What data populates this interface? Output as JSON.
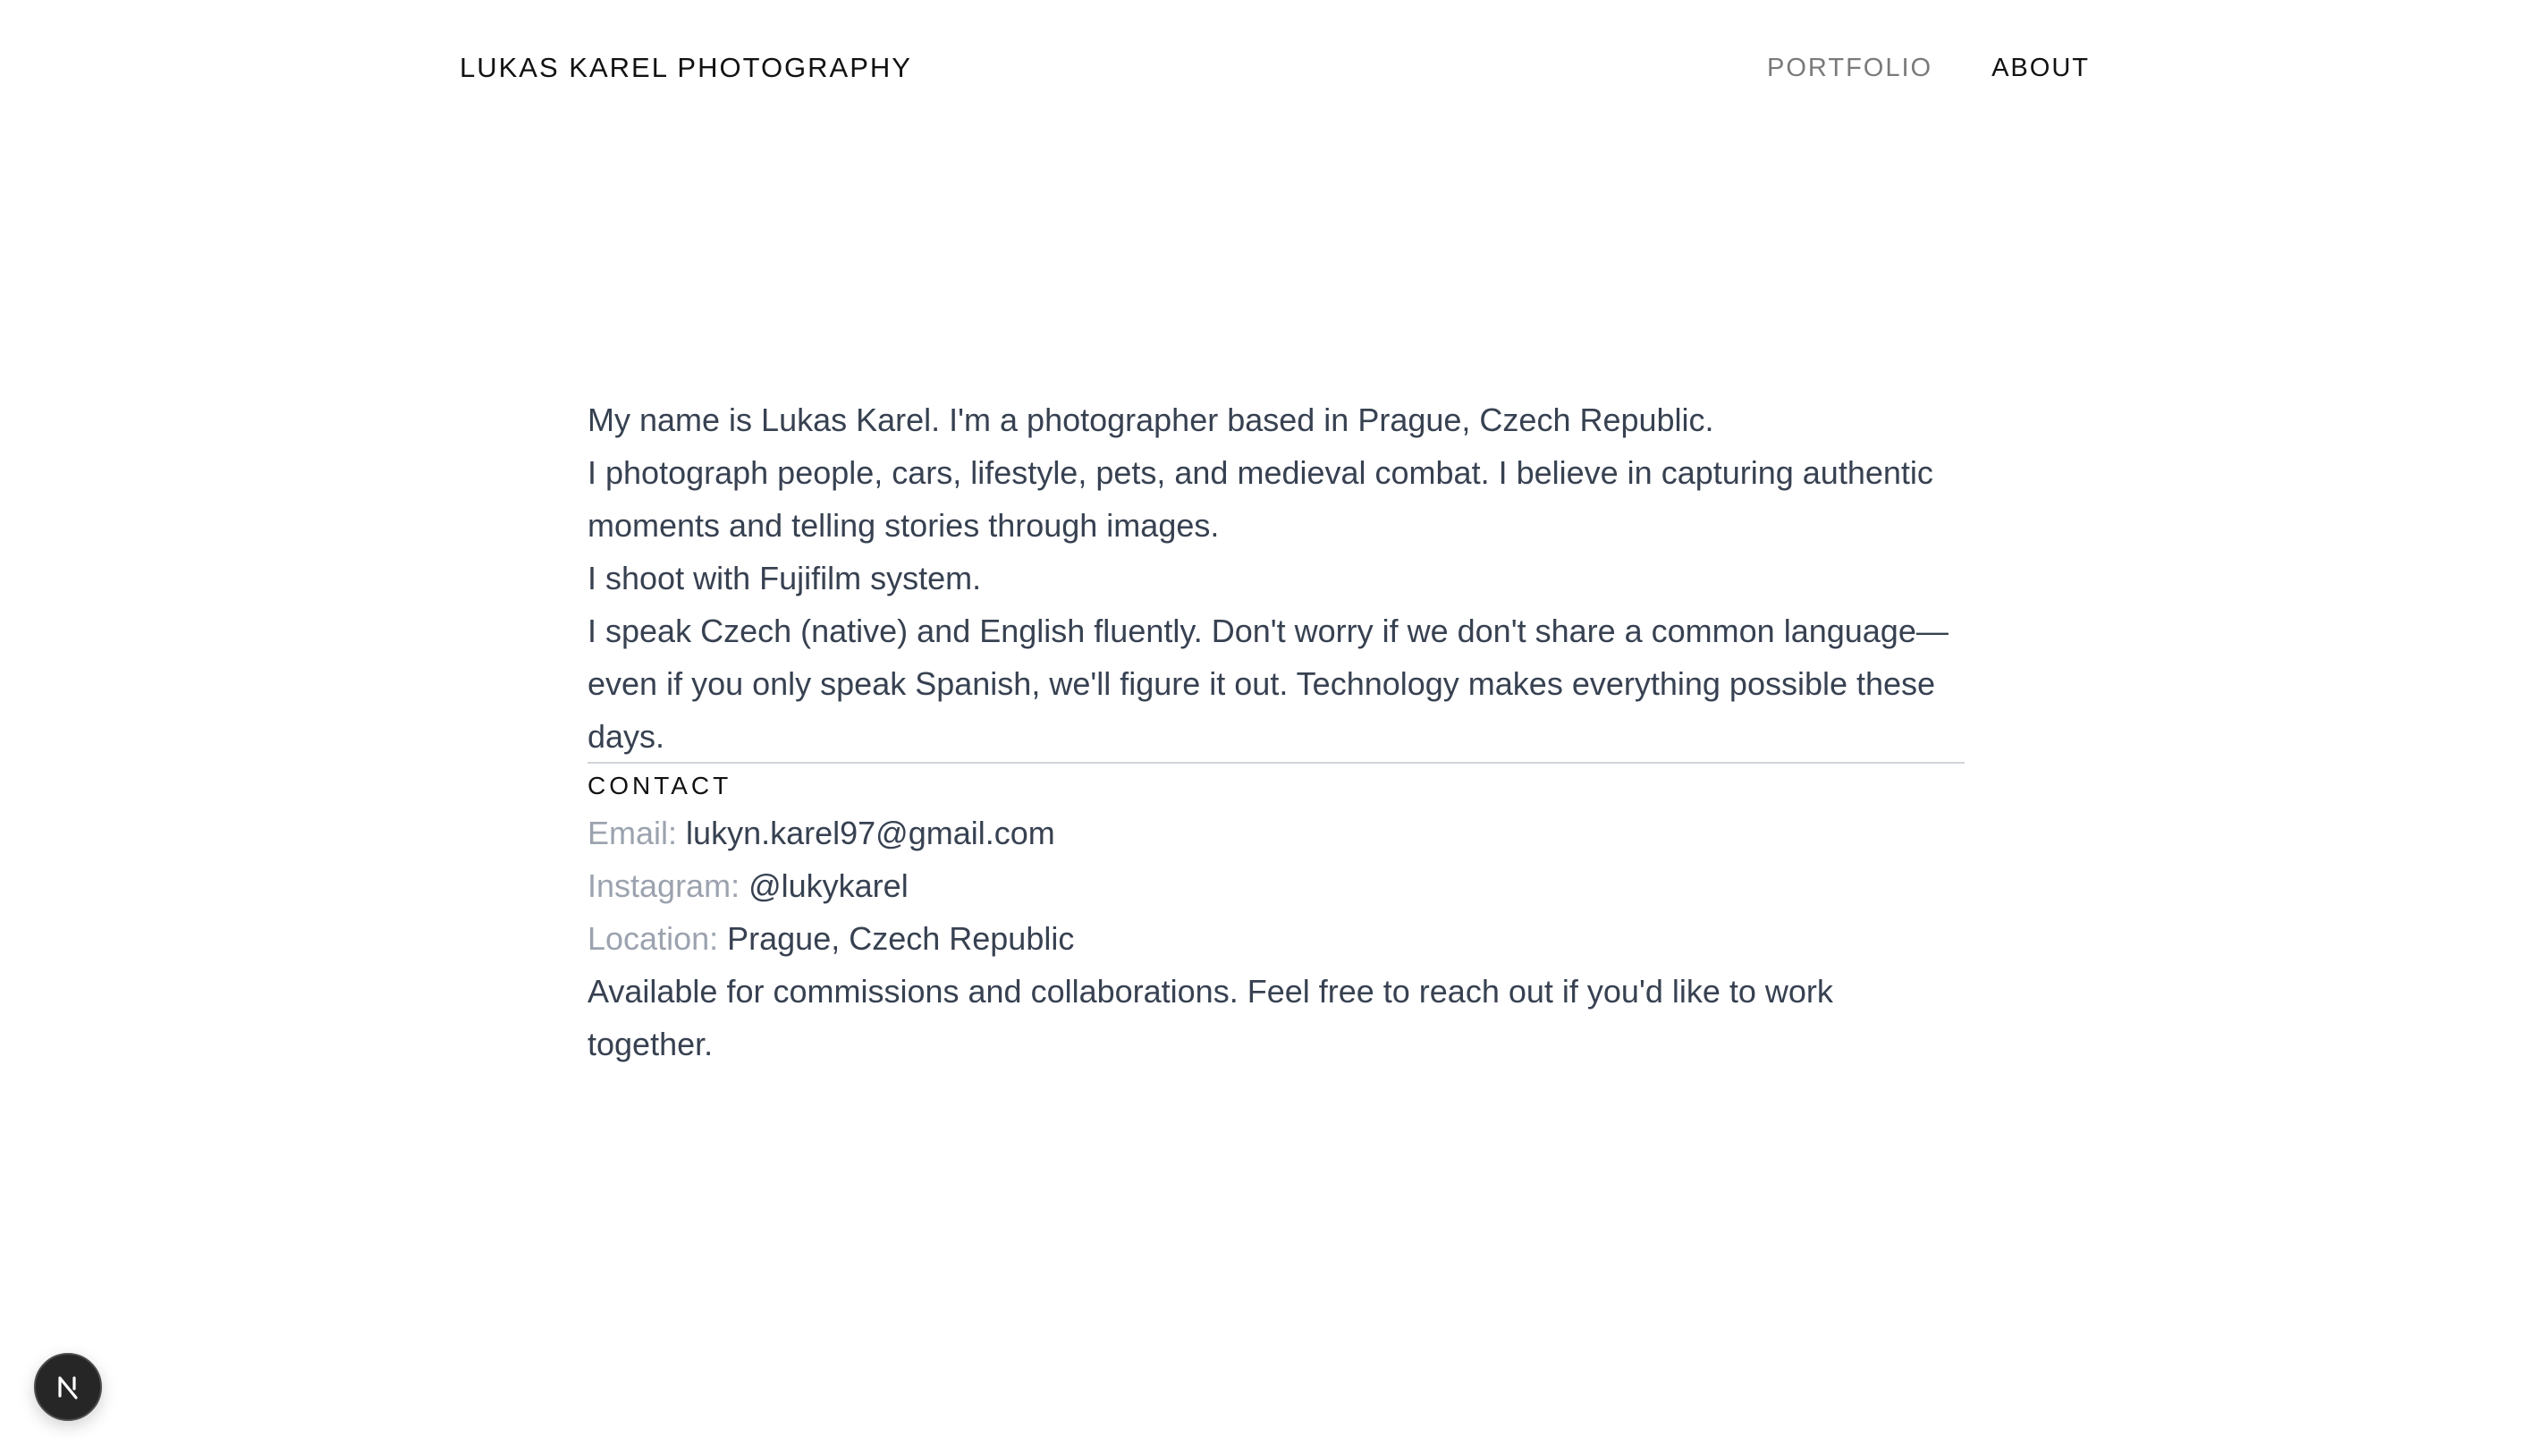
{
  "header": {
    "brand": "LUKAS KAREL PHOTOGRAPHY",
    "nav": [
      {
        "label": "PORTFOLIO"
      },
      {
        "label": "ABOUT"
      }
    ]
  },
  "about": {
    "paragraphs": [
      "My name is Lukas Karel. I'm a photographer based in Prague, Czech Republic.",
      "I photograph people, cars, lifestyle, pets, and medieval combat. I believe in capturing authentic moments and telling stories through images.",
      "I shoot with Fujifilm system.",
      "I speak Czech (native) and English fluently. Don't worry if we don't share a common language—even if you only speak Spanish, we'll figure it out. Technology makes everything possible these days."
    ]
  },
  "contact": {
    "title": "CONTACT",
    "email_label": "Email:",
    "email_value": "lukyn.karel97@gmail.com",
    "instagram_label": "Instagram:",
    "instagram_value": "@lukykarel",
    "location_label": "Location:",
    "location_value": "Prague, Czech Republic",
    "note": "Available for commissions and collaborations. Feel free to reach out if you'd like to work together."
  },
  "dev_badge": {
    "letter": "N",
    "icon": "nextjs-icon"
  },
  "colors": {
    "text": "#374151",
    "muted_label": "#9ca3af",
    "nav_muted": "#7a7a7a",
    "heading": "#111111",
    "divider": "#d1d5db",
    "badge_bg": "#262626"
  }
}
